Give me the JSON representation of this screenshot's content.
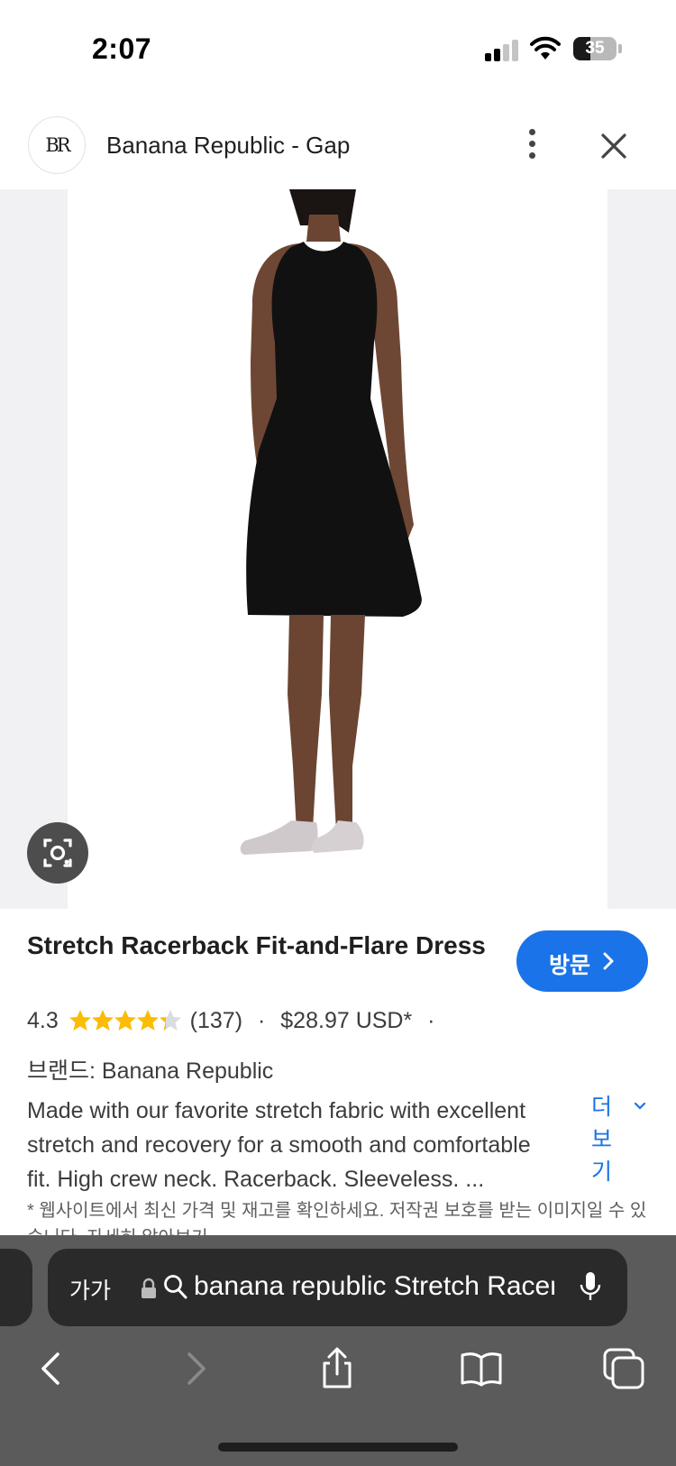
{
  "status_bar": {
    "time": "2:07",
    "battery_level": "35"
  },
  "header": {
    "site_logo_text": "BR",
    "site_title": "Banana Republic - Gap"
  },
  "product": {
    "title": "Stretch Racerback Fit-and-Flare Dress",
    "visit_label": "방문",
    "rating": "4.3",
    "rating_stars_value": 4.3,
    "review_count": "(137)",
    "separator": "·",
    "price": "$28.97 USD*",
    "brand_line": "브랜드: Banana Republic",
    "description_lines": [
      "Made with our favorite stretch fabric with excellent",
      "stretch and recovery for a smooth and comfortable",
      "fit. High crew neck. Racerback. Sleeveless. ..."
    ],
    "more_label": "더보기",
    "disclaimer": "* 웹사이트에서 최신 가격 및 재고를 확인하세요. 저작권 보호를 받는 이미지일 수 있습니다. 자세히 알아보기"
  },
  "browser": {
    "text_size_label": "가가",
    "url": "banana republic Stretch Racerback Fit-and-Flare Dress"
  },
  "colors": {
    "accent": "#1a73e8",
    "star": "#fbbc04",
    "toolbar_bg": "#5b5b5b"
  }
}
